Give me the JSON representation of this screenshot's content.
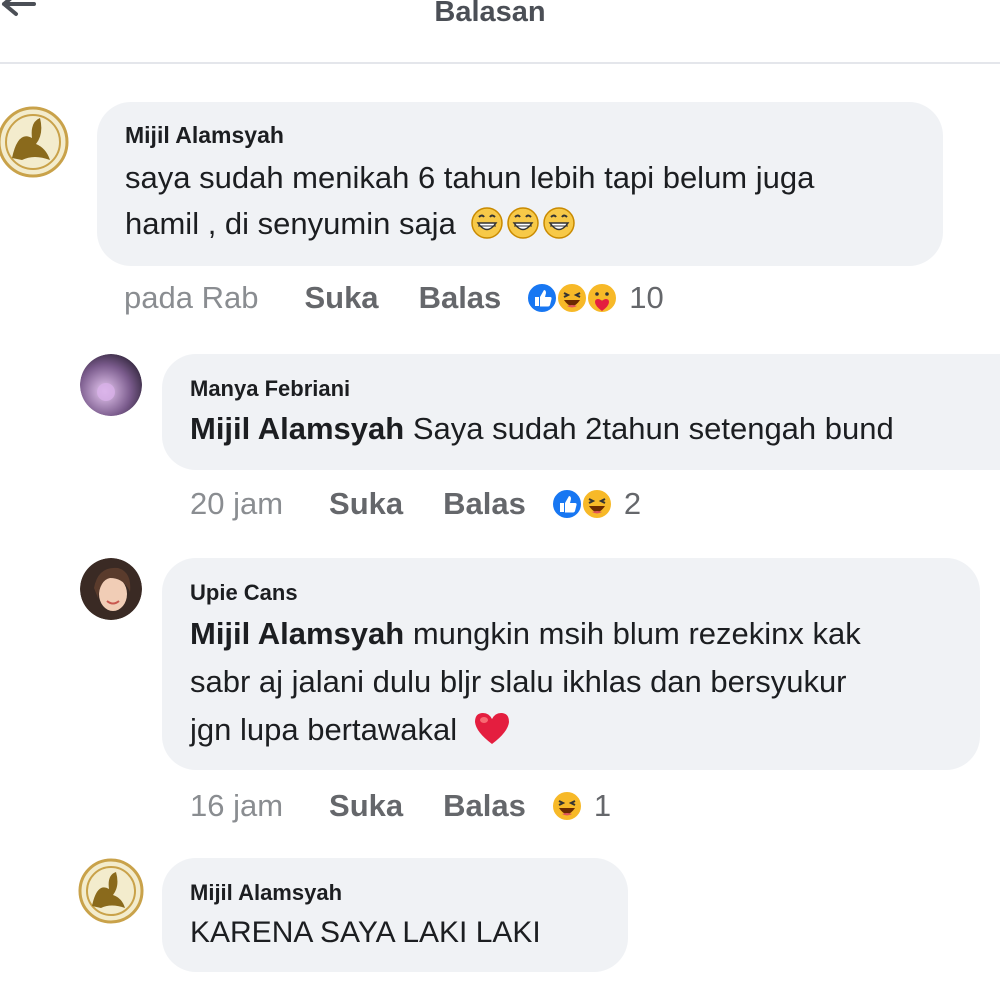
{
  "header": {
    "title": "Balasan"
  },
  "comments": [
    {
      "author": "Mijil Alamsyah",
      "line1": "saya sudah menikah 6 tahun lebih tapi belum juga",
      "line2": "hamil , di senyumin saja",
      "trailing_emoji": [
        "grin-icon",
        "grin-icon",
        "grin-icon"
      ],
      "time": "pada Rab",
      "like_label": "Suka",
      "reply_label": "Balas",
      "reactions": [
        "like-icon",
        "haha-icon",
        "care-icon"
      ],
      "reaction_count": "10"
    },
    {
      "author": "Manya Febriani",
      "mention": "Mijil Alamsyah",
      "line1": "Saya sudah 2tahun setengah bund",
      "time": "20 jam",
      "like_label": "Suka",
      "reply_label": "Balas",
      "reactions": [
        "like-icon",
        "haha-icon"
      ],
      "reaction_count": "2"
    },
    {
      "author": "Upie Cans",
      "mention": "Mijil Alamsyah",
      "line1": "mungkin msih blum rezekinx kak",
      "line2": "sabr aj jalani dulu bljr slalu ikhlas dan bersyukur",
      "line3": "jgn lupa bertawakal",
      "trailing_emoji": [
        "heart-icon"
      ],
      "time": "16 jam",
      "like_label": "Suka",
      "reply_label": "Balas",
      "reactions": [
        "haha-icon"
      ],
      "reaction_count": "1"
    },
    {
      "author": "Mijil Alamsyah",
      "line1": "KARENA SAYA LAKI LAKI"
    }
  ],
  "colors": {
    "bubble": "#f0f2f5",
    "like_blue": "#1877f2",
    "haha_yellow": "#f7b928",
    "heart_red": "#e41e3f",
    "muted_text": "#65676b"
  }
}
